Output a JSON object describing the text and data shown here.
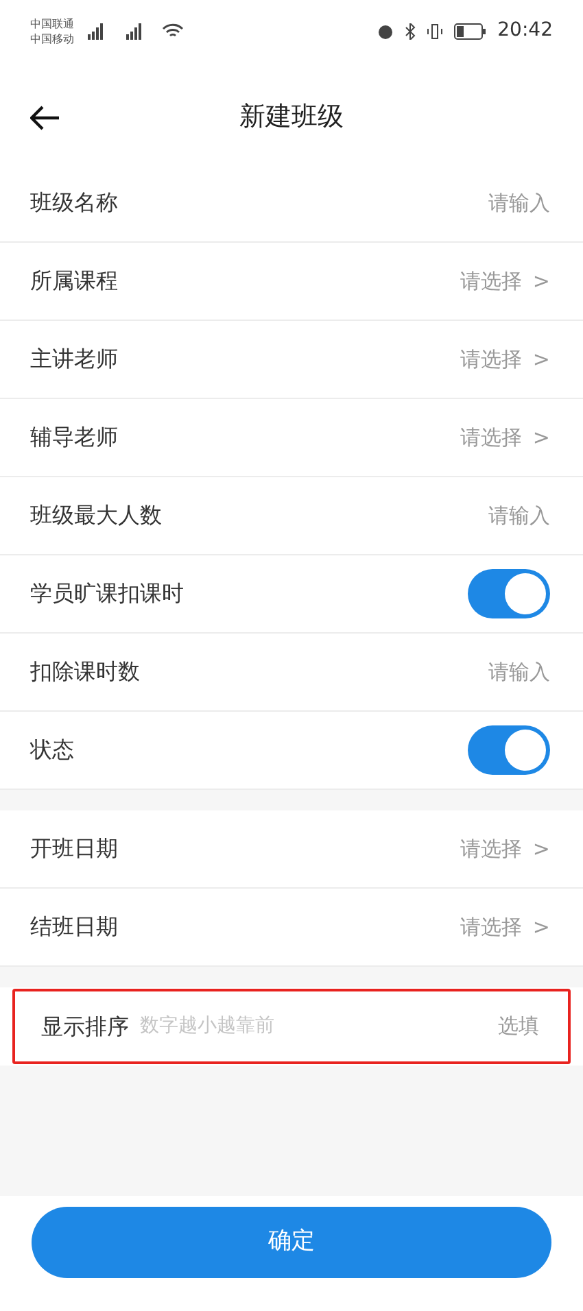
{
  "status_bar": {
    "carriers": [
      "中国联通",
      "中国移动"
    ],
    "time": "20:42"
  },
  "header": {
    "title": "新建班级"
  },
  "sections": [
    {
      "rows": [
        {
          "kind": "input",
          "label": "班级名称",
          "placeholder": "请输入"
        },
        {
          "kind": "select",
          "label": "所属课程",
          "placeholder": "请选择",
          "chevron": ">"
        },
        {
          "kind": "select",
          "label": "主讲老师",
          "placeholder": "请选择",
          "chevron": ">"
        },
        {
          "kind": "select",
          "label": "辅导老师",
          "placeholder": "请选择",
          "chevron": ">"
        },
        {
          "kind": "input",
          "label": "班级最大人数",
          "placeholder": "请输入"
        },
        {
          "kind": "switch",
          "label": "学员旷课扣课时",
          "on": true
        },
        {
          "kind": "input",
          "label": "扣除课时数",
          "placeholder": "请输入"
        },
        {
          "kind": "switch",
          "label": "状态",
          "on": true
        }
      ]
    },
    {
      "rows": [
        {
          "kind": "select",
          "label": "开班日期",
          "placeholder": "请选择",
          "chevron": ">"
        },
        {
          "kind": "select",
          "label": "结班日期",
          "placeholder": "请选择",
          "chevron": ">"
        }
      ]
    },
    {
      "rows": [
        {
          "kind": "hint",
          "label": "显示排序",
          "placeholder": "数字越小越靠前",
          "note": "选填",
          "highlighted": true
        }
      ]
    }
  ],
  "confirm_button": "确定"
}
